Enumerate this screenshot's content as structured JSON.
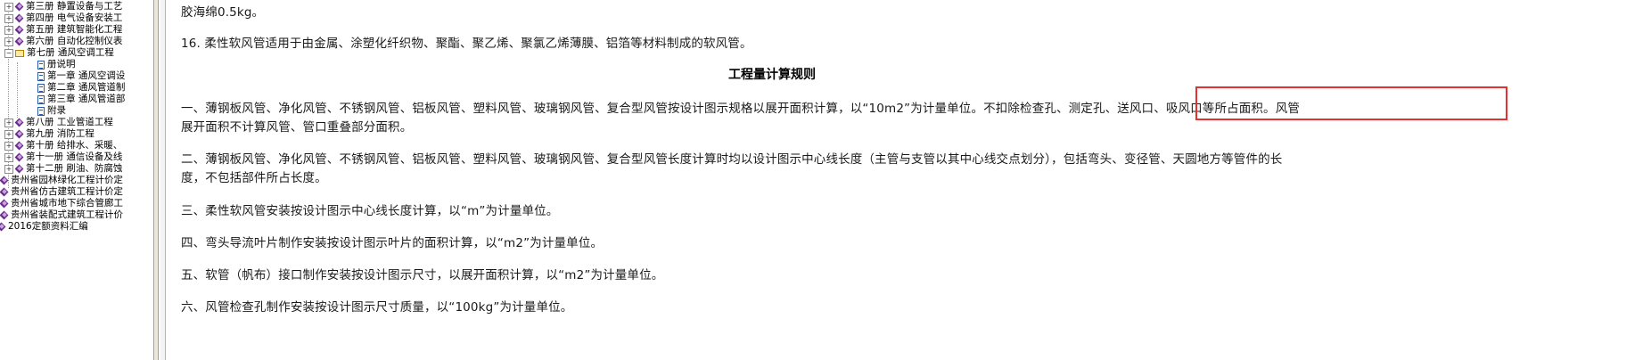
{
  "tree": {
    "items": [
      {
        "label": "第三册 静置设备与工艺",
        "icon": "book-icon",
        "expander": "+"
      },
      {
        "label": "第四册 电气设备安装工",
        "icon": "book-icon",
        "expander": "+"
      },
      {
        "label": "第五册 建筑智能化工程",
        "icon": "book-icon",
        "expander": "+"
      },
      {
        "label": "第六册 自动化控制仪表",
        "icon": "book-icon",
        "expander": "+"
      },
      {
        "label": "第七册 通风空调工程",
        "icon": "open-book-icon",
        "expander": "−"
      },
      {
        "label": "册说明",
        "icon": "document-icon"
      },
      {
        "label": "第一章 通风空调设",
        "icon": "document-icon"
      },
      {
        "label": "第二章 通风管道制",
        "icon": "document-icon"
      },
      {
        "label": "第三章 通风管道部",
        "icon": "document-icon"
      },
      {
        "label": "附录",
        "icon": "document-icon"
      },
      {
        "label": "第八册 工业管道工程",
        "icon": "book-icon",
        "expander": "+"
      },
      {
        "label": "第九册 消防工程",
        "icon": "book-icon",
        "expander": "+"
      },
      {
        "label": "第十册 给排水、采暖、",
        "icon": "book-icon",
        "expander": "+"
      },
      {
        "label": "第十一册 通信设备及线",
        "icon": "book-icon",
        "expander": "+"
      },
      {
        "label": "第十二册 刷油、防腐蚀",
        "icon": "book-icon",
        "expander": "+"
      },
      {
        "label": "贵州省园林绿化工程计价定",
        "icon": "book-icon"
      },
      {
        "label": "贵州省仿古建筑工程计价定",
        "icon": "book-icon"
      },
      {
        "label": "贵州省城市地下综合管廊工",
        "icon": "book-icon"
      },
      {
        "label": "贵州省装配式建筑工程计价",
        "icon": "book-icon"
      },
      {
        "label": "2016定额资料汇编",
        "icon": "book-icon"
      }
    ]
  },
  "content": {
    "line0": "胶海绵0.5kg。",
    "line1": "16. 柔性软风管适用于由金属、涂塑化纤织物、聚酯、聚乙烯、聚氯乙烯薄膜、铝箔等材料制成的软风管。",
    "heading": "工程量计算规则",
    "p1_line1": "一、薄钢板风管、净化风管、不锈钢风管、铝板风管、塑料风管、玻璃钢风管、复合型风管按设计图示规格以展开面积计算，以“10m2”为计量单位。不扣除检查孔、测定孔、送风口、吸风口等所占面积。风管",
    "p1_line2": "展开面积不计算风管、管口重叠部分面积。",
    "p2_line1": "二、薄钢板风管、净化风管、不锈钢风管、铝板风管、塑料风管、玻璃钢风管、复合型风管长度计算时均以设计图示中心线长度（主管与支管以其中心线交点划分），包括弯头、变径管、天圆地方等管件的长",
    "p2_line2": "度，不包括部件所占长度。",
    "p3": "三、柔性软风管安装按设计图示中心线长度计算，以“m”为计量单位。",
    "p4": "四、弯头导流叶片制作安装按设计图示叶片的面积计算，以“m2”为计量单位。",
    "p5": "五、软管（帆布）接口制作安装按设计图示尺寸，以展开面积计算，以“m2”为计量单位。",
    "p6": "六、风管检查孔制作安装按设计图示尺寸质量，以“100kg”为计量单位。"
  },
  "colors": {
    "highlight_border": "#e53030",
    "book_icon": "#6a2a8c"
  }
}
